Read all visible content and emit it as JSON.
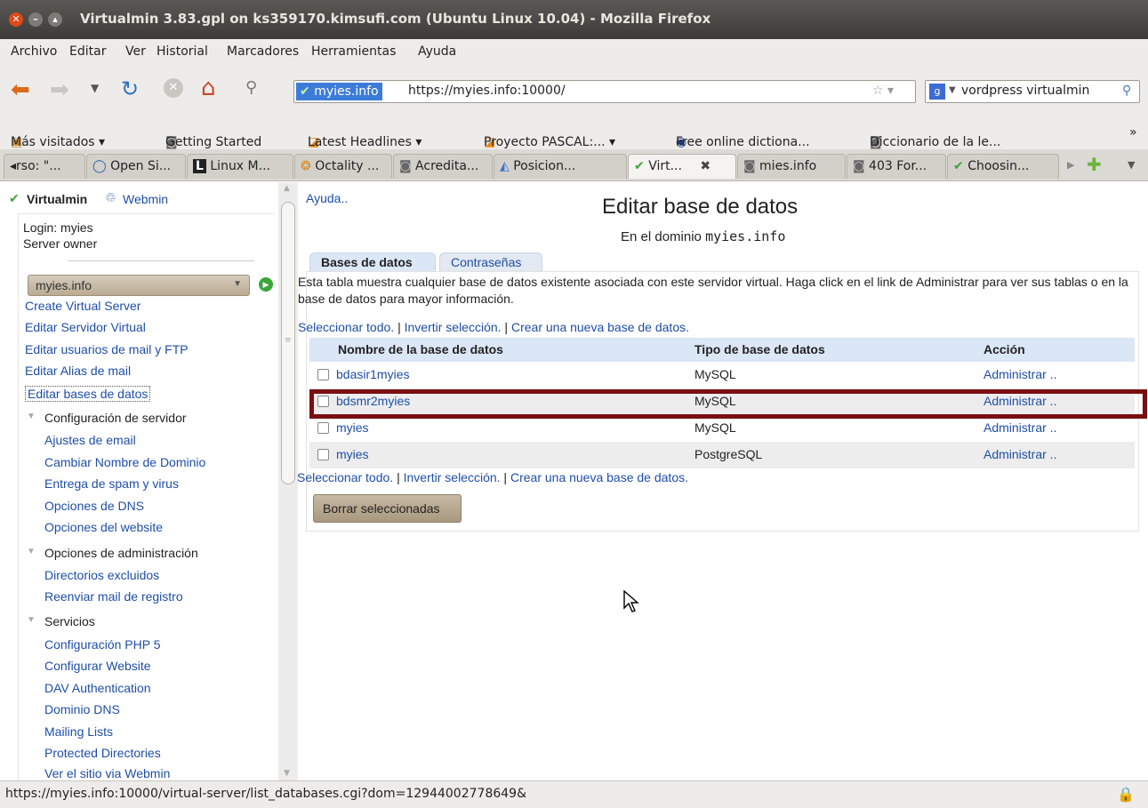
{
  "window": {
    "title": "Virtualmin 3.83.gpl on ks359170.kimsufi.com (Ubuntu Linux 10.04) - Mozilla Firefox"
  },
  "menu": [
    "Archivo",
    "Editar",
    "Ver",
    "Historial",
    "Marcadores",
    "Herramientas",
    "Ayuda"
  ],
  "navbar": {
    "site_badge": "myies.info",
    "url": "https://myies.info:10000/",
    "search_value": "vordpress virtualmin"
  },
  "bookmarks": [
    "Más visitados ▾",
    "Getting Started",
    "Latest Headlines ▾",
    "Proyecto PASCAL:... ▾",
    "Free online dictiona...",
    "Diccionario de la le...",
    "»"
  ],
  "tabs": [
    "◂rso: \"...",
    "Open Si...",
    "Linux M...",
    "Octality ...",
    "Acredita...",
    "Posicion...",
    "Virt...",
    "mies.info",
    "403 For...",
    "Choosin..."
  ],
  "sidebar": {
    "brand": "Virtualmin",
    "webmin": "Webmin",
    "login": "Login: myies",
    "role": "Server owner",
    "domain_select": "myies.info",
    "links_top": [
      "Create Virtual Server",
      "Editar Servidor Virtual",
      "Editar usuarios de mail y FTP",
      "Editar Alias de mail",
      "Editar bases de datos"
    ],
    "sec1": "Configuración de servidor",
    "sec1_links": [
      "Ajustes de email",
      "Cambiar Nombre de Dominio",
      "Entrega de spam y virus",
      "Opciones de DNS",
      "Opciones del website"
    ],
    "sec2": "Opciones de administración",
    "sec2_links": [
      "Directorios excluidos",
      "Reenviar mail de registro"
    ],
    "sec3": "Servicios",
    "sec3_links": [
      "Configuración PHP 5",
      "Configurar Website",
      "DAV Authentication",
      "Dominio DNS",
      "Mailing Lists",
      "Protected Directories",
      "Ver el sitio via Webmin"
    ]
  },
  "main": {
    "help": "Ayuda..",
    "title": "Editar base de datos",
    "subtitle_prefix": "En el dominio",
    "subtitle_domain": "myies.info",
    "tab_active": "Bases de datos",
    "tab_other": "Contraseñas",
    "description": "Esta tabla muestra cualquier base de datos existente asociada con este servidor virtual. Haga click en el link de Administrar para ver sus tablas o en la base de datos para mayor información.",
    "select_all": "Seleccionar todo.",
    "invert": "Invertir selección.",
    "create_new": "Crear una nueva base de datos.",
    "headers": [
      "Nombre de la base de datos",
      "Tipo de base de datos",
      "Acción"
    ],
    "rows": [
      {
        "name": "bdasir1myies",
        "type": "MySQL",
        "action": "Administrar .."
      },
      {
        "name": "bdsmr2myies",
        "type": "MySQL",
        "action": "Administrar .."
      },
      {
        "name": "myies",
        "type": "MySQL",
        "action": "Administrar .."
      },
      {
        "name": "myies",
        "type": "PostgreSQL",
        "action": "Administrar .."
      }
    ],
    "delete_button": "Borrar seleccionadas"
  },
  "status": {
    "url": "https://myies.info:10000/virtual-server/list_databases.cgi?dom=12944002778649&"
  },
  "colors": {
    "link": "#1e4ea8",
    "highlight_box": "#7a0e12",
    "table_header_bg": "#dbe6f6"
  }
}
